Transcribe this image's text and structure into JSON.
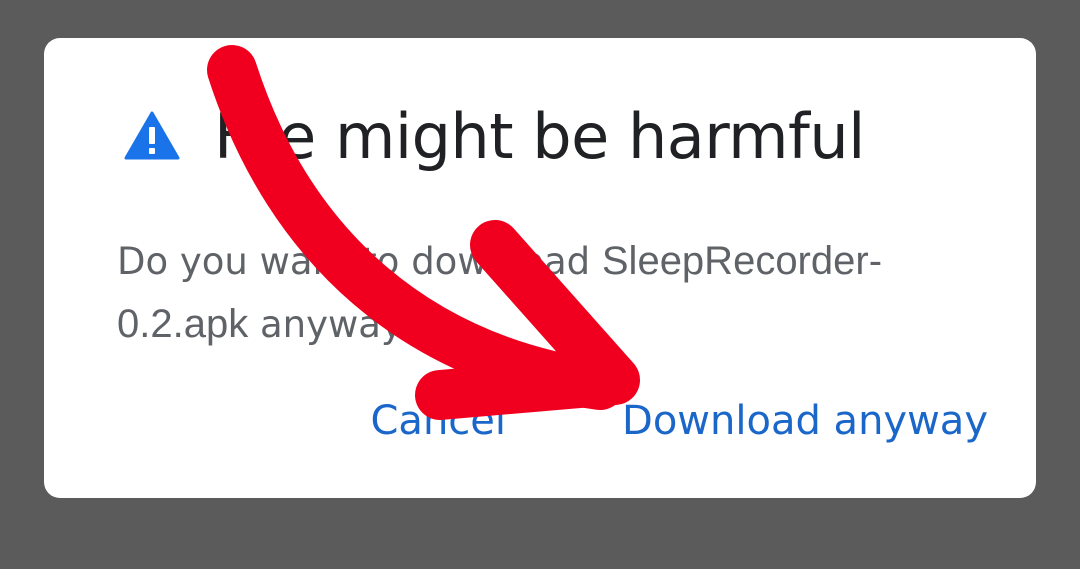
{
  "dialog": {
    "title": "File might be harmful",
    "message_prefix": "Do you want to download ",
    "file_name": "SleepRecorder-0.2.apk",
    "message_suffix": " anyway?",
    "cancel_label": "Cancel",
    "confirm_label": "Download anyway",
    "icon": "warning-icon"
  },
  "colors": {
    "backdrop": "#5b5b5b",
    "dialog_bg": "#ffffff",
    "title": "#202124",
    "body": "#5f6368",
    "accent": "#1a66c9",
    "warning_icon": "#1a73e8",
    "annotation_arrow": "#f0001e"
  }
}
